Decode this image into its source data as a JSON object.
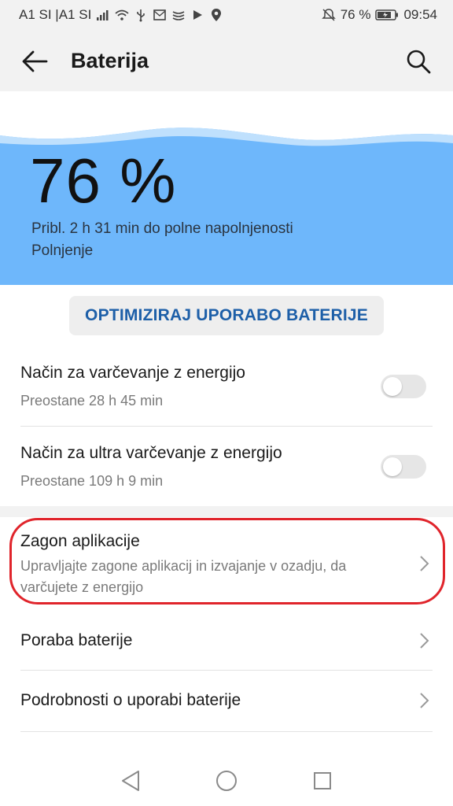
{
  "status_bar": {
    "carrier": "A1 SI |A1 SI",
    "battery_percent": "76 %",
    "time": "09:54",
    "icons": [
      "signal-icon",
      "wifi-icon",
      "usb-icon",
      "message-icon",
      "wireless-icon",
      "play-icon",
      "location-icon",
      "mute-icon",
      "battery-icon"
    ]
  },
  "header": {
    "title": "Baterija"
  },
  "battery": {
    "level": "76 %",
    "estimate": "Pribl. 2 h 31 min do polne napolnjenosti",
    "state": "Polnjenje",
    "accent_color": "#6eb7fb"
  },
  "optimize_button": "OPTIMIZIRAJ UPORABO BATERIJE",
  "settings": [
    {
      "title": "Način za varčevanje z energijo",
      "subtitle": "Preostane 28 h 45 min",
      "control": "toggle",
      "enabled": false
    },
    {
      "title": "Način za ultra varčevanje z energijo",
      "subtitle": "Preostane 109 h 9 min",
      "control": "toggle",
      "enabled": false
    }
  ],
  "menu": [
    {
      "title": "Zagon aplikacije",
      "subtitle_line1": "Upravljajte zagone aplikacij in izvajanje v ozadju, da",
      "subtitle_line2": "varčujete z energijo",
      "highlighted": true
    },
    {
      "title": "Poraba baterije"
    },
    {
      "title": "Podrobnosti o uporabi baterije"
    }
  ],
  "highlight_color": "#e0242b"
}
